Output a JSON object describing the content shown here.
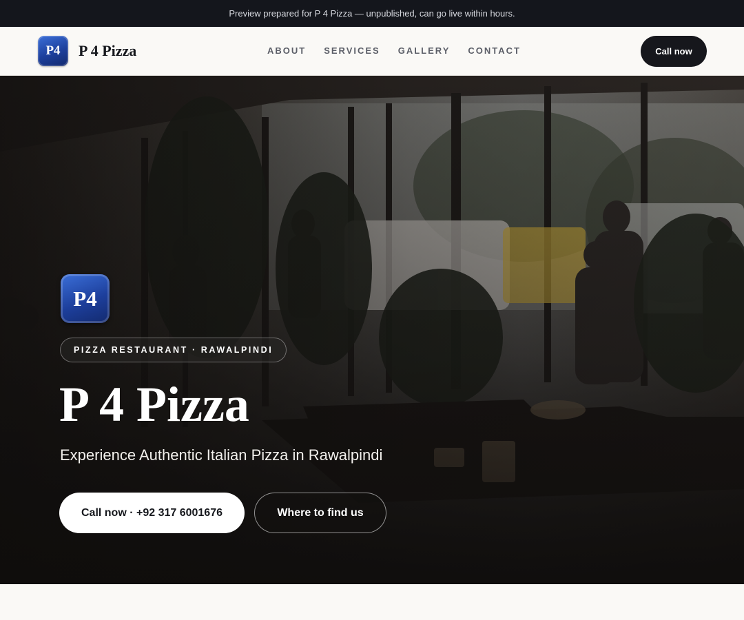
{
  "preview_banner": "Preview prepared for P 4 Pizza — unpublished, can go live within hours.",
  "brand": {
    "logo_text": "P4",
    "name": "P 4 Pizza"
  },
  "nav": {
    "items": [
      {
        "label": "ABOUT"
      },
      {
        "label": "SERVICES"
      },
      {
        "label": "GALLERY"
      },
      {
        "label": "CONTACT"
      }
    ],
    "cta": "Call now"
  },
  "hero": {
    "logo_text": "P4",
    "tag": "PIZZA RESTAURANT · RAWALPINDI",
    "title": "P 4 Pizza",
    "subtitle": "Experience Authentic Italian Pizza in Rawalpindi",
    "primary_button": "Call now · +92 317 6001676",
    "secondary_button": "Where to find us"
  },
  "colors": {
    "dark": "#16171c",
    "accent_blue": "#1d3f9c",
    "background": "#faf9f6"
  }
}
